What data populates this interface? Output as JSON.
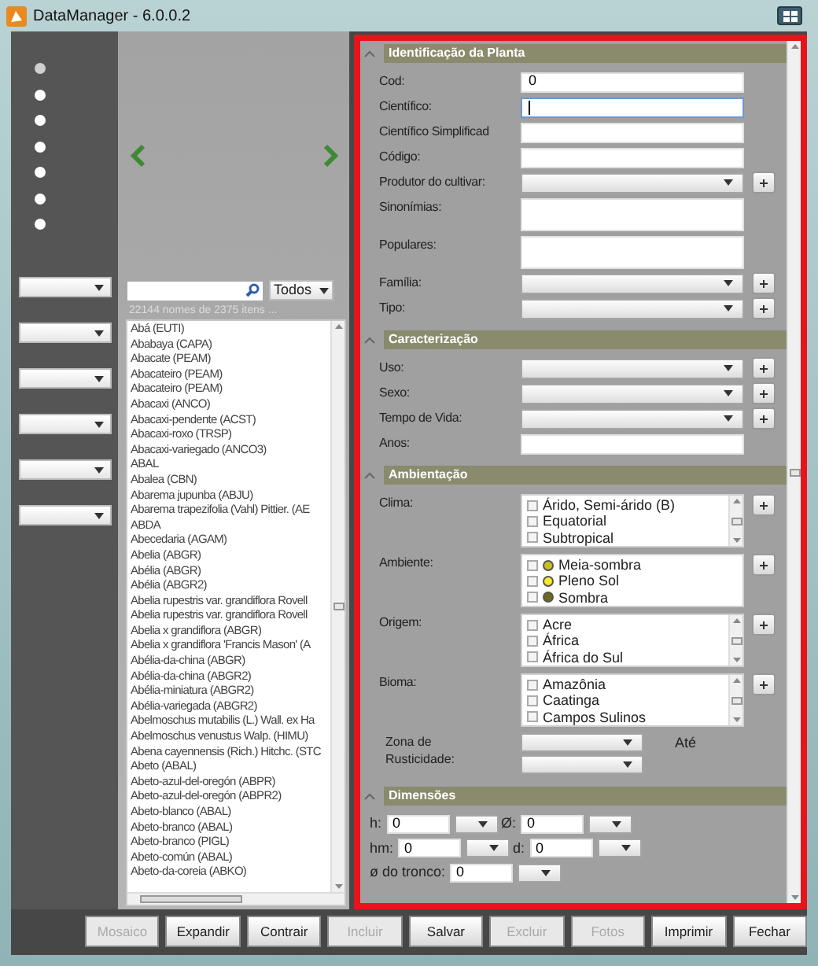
{
  "window": {
    "title": "DataManager - 6.0.0.2"
  },
  "filters": {
    "radios": [
      {
        "selected": true
      },
      {
        "selected": false
      },
      {
        "selected": false
      },
      {
        "selected": false
      },
      {
        "selected": false
      },
      {
        "selected": false
      },
      {
        "selected": false
      }
    ]
  },
  "browser": {
    "filter": {
      "value": "Todos"
    },
    "count": "22144 nomes de 2375 itens ...",
    "items": [
      "Abá (EUTI)",
      "Ababaya (CAPA)",
      "Abacate (PEAM)",
      "Abacateiro (PEAM)",
      "Abacateiro (PEAM)",
      "Abacaxi (ANCO)",
      "Abacaxi-pendente (ACST)",
      "Abacaxi-roxo (TRSP)",
      "Abacaxi-variegado (ANCO3)",
      "ABAL",
      "Abalea (CBN)",
      "Abarema jupunba (ABJU)",
      "Abarema trapezifolia (Vahl) Pittier. (AE",
      "ABDA",
      "Abecedaria (AGAM)",
      "Abelia (ABGR)",
      "Abélia (ABGR)",
      "Abélia (ABGR2)",
      "Abelia rupestris var. grandiflora Rovell",
      "Abelia rupestris var. grandiflora Rovell",
      "Abelia x grandiflora (ABGR)",
      "Abelia x grandiflora 'Francis Mason' (A",
      "Abélia-da-china (ABGR)",
      "Abélia-da-china (ABGR2)",
      "Abélia-miniatura (ABGR2)",
      "Abélia-variegada (ABGR2)",
      "Abelmoschus mutabilis (L.) Wall. ex Ha",
      "Abelmoschus venustus Walp. (HIMU)",
      "Abena cayennensis (Rich.) Hitchc. (STC",
      "Abeto (ABAL)",
      "Abeto-azul-del-oregón (ABPR)",
      "Abeto-azul-del-oregón (ABPR2)",
      "Abeto-blanco (ABAL)",
      "Abeto-branco (ABAL)",
      "Abeto-branco (PIGL)",
      "Abeto-común (ABAL)",
      "Abeto-da-coreia (ABKO)"
    ]
  },
  "sections": [
    {
      "title": "Identificação da Planta",
      "expanded": true,
      "fields": [
        {
          "kind": "text",
          "label": "Cod:",
          "value": "0",
          "focused": false
        },
        {
          "kind": "text",
          "label": "Científico:",
          "focused": true
        },
        {
          "kind": "text",
          "label": "Científico Simplificad",
          "focused": false
        },
        {
          "kind": "text",
          "label": "Código:",
          "focused": false
        },
        {
          "kind": "combo",
          "label": "Produtor do cultivar:",
          "plus": true
        },
        {
          "kind": "memo",
          "label": "Sinonímias:"
        },
        {
          "kind": "memo",
          "label": "Populares:"
        },
        {
          "kind": "combo",
          "label": "Família:",
          "plus": true
        },
        {
          "kind": "combo",
          "label": "Tipo:",
          "plus": true
        }
      ]
    },
    {
      "title": "Caracterização",
      "expanded": true,
      "fields": [
        {
          "kind": "combo",
          "label": "Uso:",
          "plus": true
        },
        {
          "kind": "combo",
          "label": "Sexo:",
          "plus": true
        },
        {
          "kind": "combo",
          "label": "Tempo de Vida:",
          "plus": true
        },
        {
          "kind": "text",
          "label": "Anos:",
          "focused": false
        }
      ]
    },
    {
      "title": "Ambientação",
      "expanded": true,
      "fields": [
        {
          "kind": "checklist",
          "label": "Clima:",
          "plus": true,
          "scroll": true,
          "options": [
            {
              "text": "Árido, Semi-árido (B)",
              "checked": false
            },
            {
              "text": "Equatorial",
              "checked": false
            },
            {
              "text": "Subtropical",
              "checked": false
            }
          ]
        },
        {
          "kind": "checklist",
          "label": "Ambiente:",
          "plus": true,
          "scroll": false,
          "options": [
            {
              "text": "Meia-sombra",
              "checked": false,
              "color": "#c8c020"
            },
            {
              "text": "Pleno Sol",
              "checked": false,
              "color": "#f4ec20"
            },
            {
              "text": "Sombra",
              "checked": false,
              "color": "#6e6a18"
            }
          ]
        },
        {
          "kind": "checklist",
          "label": "Origem:",
          "plus": true,
          "scroll": true,
          "options": [
            {
              "text": "Acre",
              "checked": false
            },
            {
              "text": "África",
              "checked": false
            },
            {
              "text": "África do Sul",
              "checked": false
            }
          ]
        },
        {
          "kind": "checklist",
          "label": "Bioma:",
          "plus": true,
          "scroll": true,
          "options": [
            {
              "text": "Amazônia",
              "checked": false
            },
            {
              "text": "Caatinga",
              "checked": false
            },
            {
              "text": "Campos Sulinos",
              "checked": false
            }
          ]
        },
        {
          "kind": "range",
          "label": "Zona de Rusticidade:",
          "to_label": "Até"
        }
      ]
    },
    {
      "title": "Dimensões",
      "expanded": true,
      "fields": [
        {
          "kind": "dims",
          "items": [
            {
              "label": "h:",
              "value": "0"
            },
            {
              "label": "Ø:",
              "value": "0"
            }
          ]
        },
        {
          "kind": "dims",
          "items": [
            {
              "label": "hm:",
              "value": "0"
            },
            {
              "label": "d:",
              "value": "0"
            }
          ]
        },
        {
          "kind": "dims",
          "items": [
            {
              "label": "ø do tronco:",
              "value": "0"
            }
          ]
        }
      ]
    }
  ],
  "buttons": [
    {
      "label": "Mosaico",
      "disabled": true
    },
    {
      "label": "Expandir",
      "disabled": false
    },
    {
      "label": "Contrair",
      "disabled": false
    },
    {
      "label": "Incluir",
      "disabled": true
    },
    {
      "label": "Salvar",
      "disabled": false
    },
    {
      "label": "Excluir",
      "disabled": true
    },
    {
      "label": "Fotos",
      "disabled": true
    },
    {
      "label": "Imprimir",
      "disabled": false
    },
    {
      "label": "Fechar",
      "disabled": false
    }
  ]
}
